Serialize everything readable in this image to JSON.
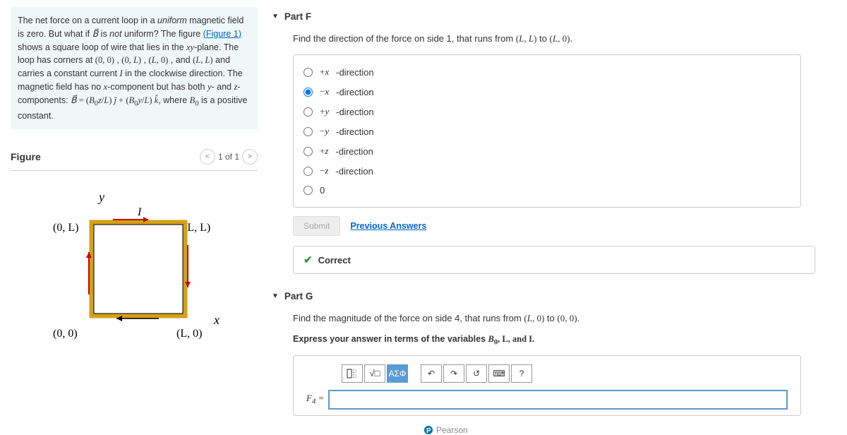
{
  "partF": {
    "title": "Part F",
    "question_pre": "Find the direction of the force on side 1, that runs from ",
    "question_math1": "(L, L)",
    "question_mid": " to ",
    "question_math2": "(L, 0)",
    "question_post": ".",
    "choices": [
      "+x-direction",
      "−x-direction",
      "+y-direction",
      "−y-direction",
      "+z-direction",
      "−z-direction",
      "0"
    ],
    "selected_index": 1,
    "submit": "Submit",
    "prev": "Previous Answers",
    "correct": "Correct"
  },
  "partG": {
    "title": "Part G",
    "q1": "Find the magnitude of the force on side 4, that runs from ",
    "q_m1": "(L, 0)",
    "q_mid": " to ",
    "q_m2": "(0, 0)",
    "q_post": ".",
    "instr1": "Express your answer in terms of the variables ",
    "instr_m": "B₀",
    "instr2": ", L, and I.",
    "label_pre": "F",
    "label_sub": "4",
    "eq": " = ",
    "sigma": "ΑΣΦ",
    "help": "?"
  },
  "problem": {
    "text": "The net force on a current loop in a uniform magnetic field is zero. But what if B⃗ is not uniform? The figure (Figure 1) shows a square loop of wire that lies in the xy-plane. The loop has corners at (0, 0) , (0, L) , (L, 0) , and (L, L) and carries a constant current I in the clockwise direction. The magnetic field has no x-component but has both y- and z-components: B⃗ = (B₀z/L) ĵ + (B₀y/L) k̂, where B₀ is a positive constant.",
    "figlink": "Figure 1"
  },
  "figure": {
    "title": "Figure",
    "counter": "1 of 1",
    "labels": {
      "y": "y",
      "x": "x",
      "I": "I",
      "c00": "(0, 0)",
      "c0L": "(0, L)",
      "cL0": "(L, 0)",
      "cLL": "(L, L)"
    }
  },
  "brand": "Pearson"
}
